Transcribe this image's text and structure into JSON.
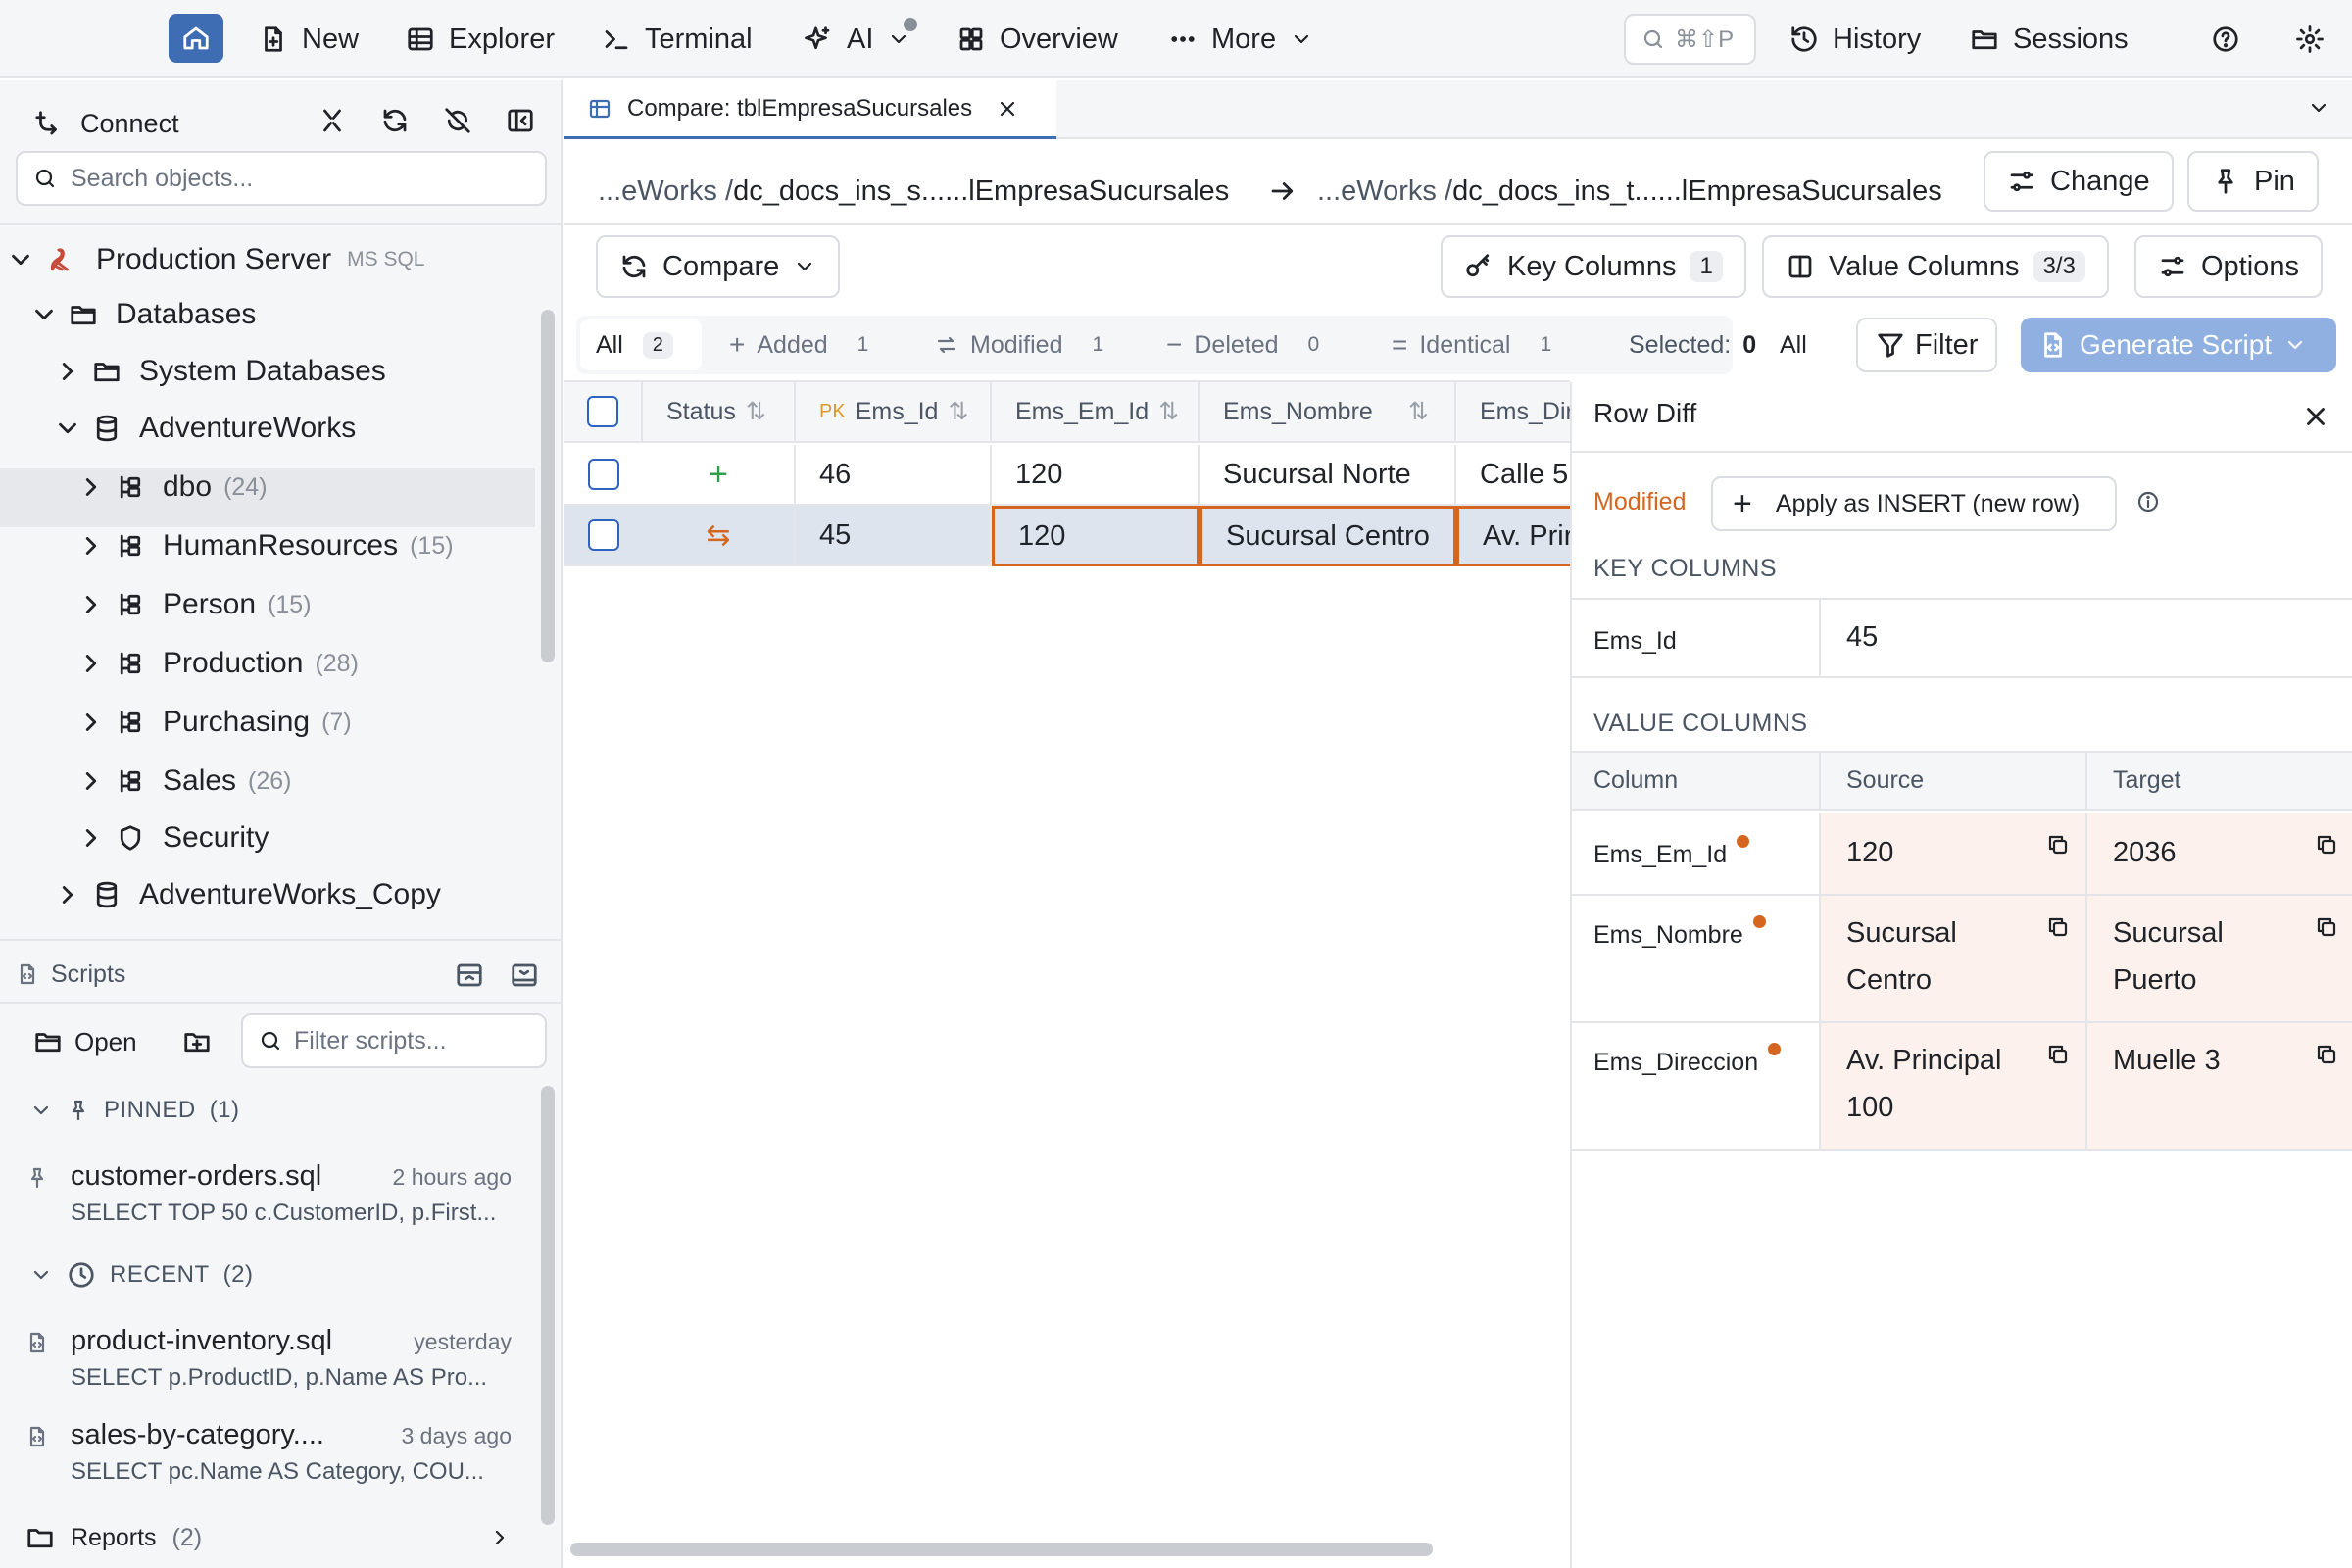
{
  "topbar": {
    "new": "New",
    "explorer": "Explorer",
    "terminal": "Terminal",
    "ai": "AI",
    "overview": "Overview",
    "more": "More",
    "search_shortcut": "⌘⇧P",
    "history": "History",
    "sessions": "Sessions"
  },
  "connect": {
    "title": "Connect",
    "search_placeholder": "Search objects..."
  },
  "tree": {
    "server": {
      "label": "Production Server",
      "tag": "MS SQL"
    },
    "databases": "Databases",
    "system_databases": "System Databases",
    "adventureworks": "AdventureWorks",
    "schemas": [
      {
        "label": "dbo",
        "count": "(24)"
      },
      {
        "label": "HumanResources",
        "count": "(15)"
      },
      {
        "label": "Person",
        "count": "(15)"
      },
      {
        "label": "Production",
        "count": "(28)"
      },
      {
        "label": "Purchasing",
        "count": "(7)"
      },
      {
        "label": "Sales",
        "count": "(26)"
      }
    ],
    "security": "Security",
    "adventureworks_copy": "AdventureWorks_Copy"
  },
  "scripts": {
    "title": "Scripts",
    "open": "Open",
    "filter_placeholder": "Filter scripts...",
    "pinned_label": "PINNED",
    "pinned_count": "(1)",
    "recent_label": "RECENT",
    "recent_count": "(2)",
    "pinned": [
      {
        "name": "customer-orders.sql",
        "time": "2 hours ago",
        "preview": "SELECT TOP 50 c.CustomerID, p.First..."
      }
    ],
    "recent": [
      {
        "name": "product-inventory.sql",
        "time": "yesterday",
        "preview": "SELECT p.ProductID, p.Name AS Pro..."
      },
      {
        "name": "sales-by-category....",
        "time": "3 days ago",
        "preview": "SELECT pc.Name AS Category, COU..."
      }
    ],
    "reports": "Reports",
    "reports_count": "(2)"
  },
  "tab": {
    "label": "Compare: tblEmpresaSucursales"
  },
  "path": {
    "source_prefix": "...eWorks / ",
    "source_name": "dc_docs_ins_s......lEmpresaSucursales",
    "target_prefix": "...eWorks / ",
    "target_name": "dc_docs_ins_t......lEmpresaSucursales",
    "change": "Change",
    "pin": "Pin"
  },
  "toolbar": {
    "compare": "Compare",
    "key_columns": "Key Columns",
    "key_columns_count": "1",
    "value_columns": "Value Columns",
    "value_columns_count": "3/3",
    "options": "Options"
  },
  "filters": {
    "all": "All",
    "all_count": "2",
    "added": "Added",
    "added_count": "1",
    "modified": "Modified",
    "modified_count": "1",
    "deleted": "Deleted",
    "deleted_count": "0",
    "identical": "Identical",
    "identical_count": "1",
    "selected_label": "Selected:",
    "selected_count": "0",
    "select_all": "All",
    "filter": "Filter",
    "generate_script": "Generate Script"
  },
  "grid": {
    "columns": {
      "status": "Status",
      "pk": "PK",
      "id": "Ems_Id",
      "em_id": "Ems_Em_Id",
      "nombre": "Ems_Nombre",
      "direccion": "Ems_Dir"
    },
    "rows": [
      {
        "status": "+",
        "id": "46",
        "em_id": "120",
        "nombre": "Sucursal Norte",
        "direccion": "Calle 5"
      },
      {
        "status": "⇆",
        "id": "45",
        "em_id": "120",
        "nombre": "Sucursal Centro",
        "direccion": "Av. Prir"
      }
    ]
  },
  "rowdiff": {
    "title": "Row Diff",
    "state": "Modified",
    "apply_insert": "Apply as INSERT (new row)",
    "key_columns_label": "KEY COLUMNS",
    "key_name": "Ems_Id",
    "key_value": "45",
    "value_columns_label": "VALUE COLUMNS",
    "headers": {
      "column": "Column",
      "source": "Source",
      "target": "Target"
    },
    "rows": [
      {
        "column": "Ems_Em_Id",
        "source": "120",
        "target": "2036"
      },
      {
        "column": "Ems_Nombre",
        "source": "Sucursal Centro",
        "target": "Sucursal Puerto"
      },
      {
        "column": "Ems_Direccion",
        "source": "Av. Principal 100",
        "target": "Muelle 3"
      }
    ]
  },
  "colors": {
    "accent": "#3f6db3",
    "modified": "#d4661f",
    "added": "#2e9e4a",
    "diff_bg": "#fcf1ec"
  }
}
